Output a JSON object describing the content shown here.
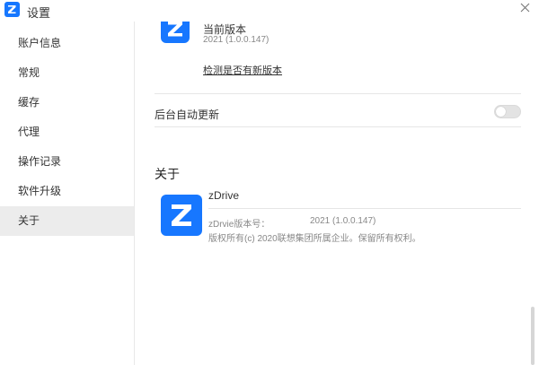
{
  "window": {
    "title": "设置",
    "close_label": "close"
  },
  "sidebar": {
    "items": [
      {
        "label": "账户信息",
        "active": false
      },
      {
        "label": "常规",
        "active": false
      },
      {
        "label": "缓存",
        "active": false
      },
      {
        "label": "代理",
        "active": false
      },
      {
        "label": "操作记录",
        "active": false
      },
      {
        "label": "软件升级",
        "active": false
      },
      {
        "label": "关于",
        "active": true
      }
    ]
  },
  "upgrade": {
    "current_version_label": "当前版本",
    "current_version": "2021 (1.0.0.147)",
    "check_update_link": "检测是否有新版本",
    "auto_update_label": "后台自动更新",
    "auto_update_enabled": false
  },
  "about": {
    "section_title": "关于",
    "app_name": "zDrive",
    "version_label": "zDrvie版本号：",
    "version_value": "2021 (1.0.0.147)",
    "copyright": "版权所有(c) 2020联想集团所属企业。保留所有权利。"
  },
  "icons": {
    "app_logo": "z-logo-icon",
    "close": "close-icon"
  },
  "colors": {
    "brand": "#1777ff",
    "active_nav_bg": "#ececec",
    "muted_text": "#888888"
  }
}
